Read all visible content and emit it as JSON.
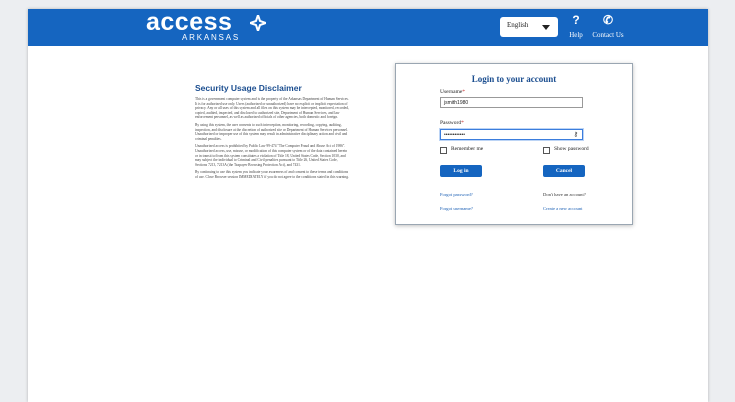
{
  "header": {
    "logo_text": "access",
    "logo_sub": "ARKANSAS",
    "language": "English",
    "help_label": "Help",
    "help_icon": "?",
    "contact_label": "Contact Us",
    "contact_icon": "✆"
  },
  "disclaimer": {
    "title": "Security Usage Disclaimer",
    "paragraphs": [
      "This is a government computer system and is the property of the Arkansas Department of Human Services. It is for authorized use only. Users (authorized or unauthorized) have no explicit or implicit expectation of privacy. Any or all uses of this system and all files on this system may be intercepted, monitored, recorded, copied, audited, inspected, and disclosed to authorized site, Department of Human Services, and law enforcement personnel, as well as authorized officials of other agencies, both domestic and foreign.",
      "By using this system, the user consents to such interception, monitoring, recording, copying, auditing, inspection, and disclosure at the discretion of authorized site or Department of Human Services personnel. Unauthorized or improper use of this system may result in administrative disciplinary action and civil and criminal penalties.",
      "Unauthorized access is prohibited by Public Law 99-474 \"The Computer Fraud and Abuse Act of 1986\". Unauthorized access, use, misuse, or modification of this computer system or of the data contained herein or in transit to/from this system constitutes a violation of Title 18, United States Code, Section 1030, and may subject the individual to Criminal and Civil penalties pursuant to Title 26, United States Code, Sections 7213, 7213A (the Taxpayer Browsing Protection Act), and 7431.",
      "By continuing to use this system you indicate your awareness of and consent to these terms and conditions of use. Close Browser session IMMEDIATELY if you do not agree to the conditions stated in this warning."
    ]
  },
  "login": {
    "title": "Login to your account",
    "username_label": "Username",
    "username_value": "jsmith1980",
    "password_label": "Password",
    "password_value": "••••••••••••",
    "remember_label": "Remember me",
    "show_password_label": "Show password",
    "login_button": "Log in",
    "cancel_button": "Cancel",
    "forgot_password": "Forgot password?",
    "no_account": "Don't have an account?",
    "forgot_username": "Forgot username?",
    "create_account": "Create a new account"
  },
  "colors": {
    "brand": "#1565c0",
    "title": "#1a4d8f",
    "link": "#1a5fb4"
  }
}
